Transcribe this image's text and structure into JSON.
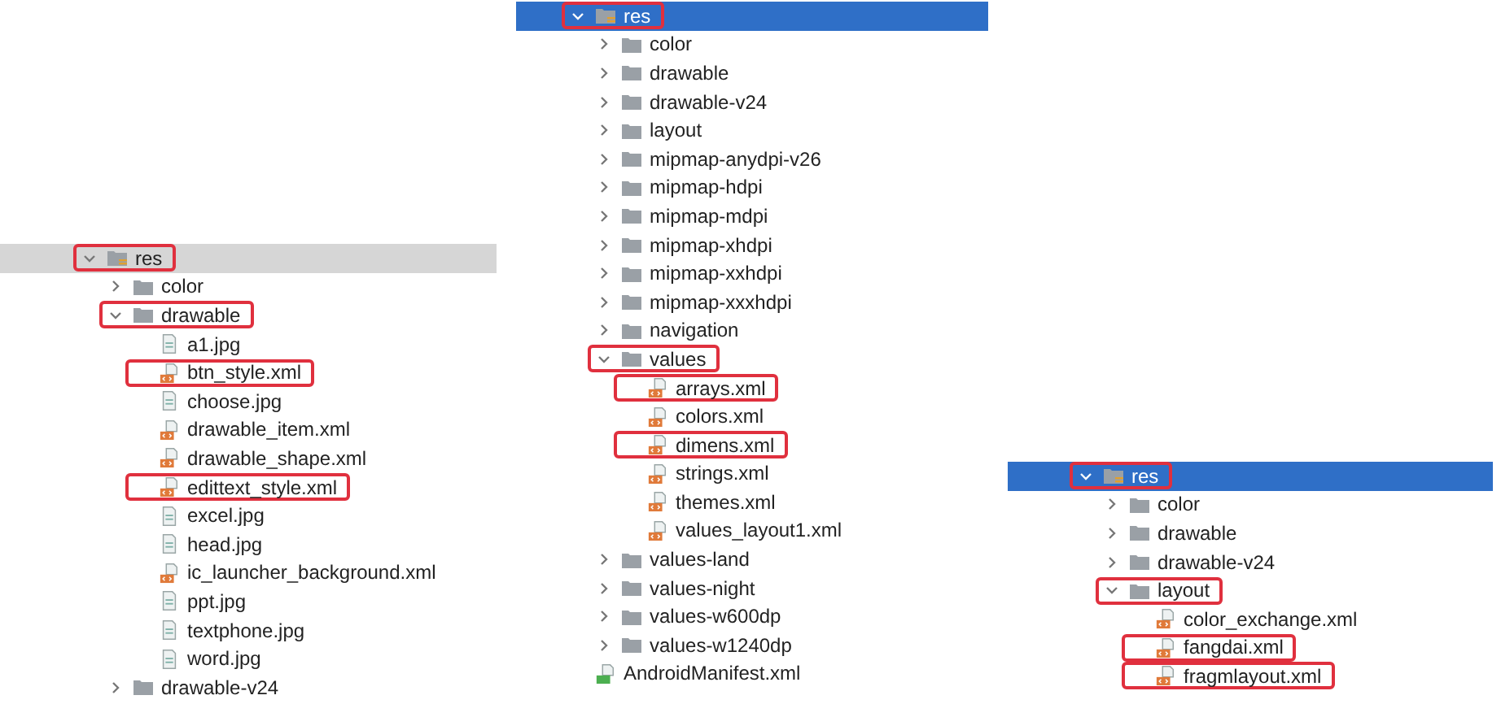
{
  "panels": [
    {
      "focused": false,
      "tree": [
        {
          "name": "res",
          "kind": "resfolder",
          "expanded": true,
          "selected": true,
          "highlighted": true,
          "children": [
            {
              "name": "color",
              "kind": "folder",
              "expanded": false,
              "selected": false,
              "highlighted": false
            },
            {
              "name": "drawable",
              "kind": "folder",
              "expanded": true,
              "selected": false,
              "highlighted": true,
              "children": [
                {
                  "name": "a1.jpg",
                  "kind": "image",
                  "selected": false,
                  "highlighted": false
                },
                {
                  "name": "btn_style.xml",
                  "kind": "xml",
                  "selected": false,
                  "highlighted": true
                },
                {
                  "name": "choose.jpg",
                  "kind": "image",
                  "selected": false,
                  "highlighted": false
                },
                {
                  "name": "drawable_item.xml",
                  "kind": "xml",
                  "selected": false,
                  "highlighted": false
                },
                {
                  "name": "drawable_shape.xml",
                  "kind": "xml",
                  "selected": false,
                  "highlighted": false
                },
                {
                  "name": "edittext_style.xml",
                  "kind": "xml",
                  "selected": false,
                  "highlighted": true
                },
                {
                  "name": "excel.jpg",
                  "kind": "image",
                  "selected": false,
                  "highlighted": false
                },
                {
                  "name": "head.jpg",
                  "kind": "image",
                  "selected": false,
                  "highlighted": false
                },
                {
                  "name": "ic_launcher_background.xml",
                  "kind": "xml",
                  "selected": false,
                  "highlighted": false
                },
                {
                  "name": "ppt.jpg",
                  "kind": "image",
                  "selected": false,
                  "highlighted": false
                },
                {
                  "name": "textphone.jpg",
                  "kind": "image",
                  "selected": false,
                  "highlighted": false
                },
                {
                  "name": "word.jpg",
                  "kind": "image",
                  "selected": false,
                  "highlighted": false
                }
              ]
            },
            {
              "name": "drawable-v24",
              "kind": "folder",
              "expanded": false,
              "selected": false,
              "highlighted": false
            }
          ]
        }
      ]
    },
    {
      "focused": true,
      "tree": [
        {
          "name": "res",
          "kind": "resfolder",
          "expanded": true,
          "selected": true,
          "highlighted": true,
          "children": [
            {
              "name": "color",
              "kind": "folder",
              "expanded": false,
              "selected": false,
              "highlighted": false
            },
            {
              "name": "drawable",
              "kind": "folder",
              "expanded": false,
              "selected": false,
              "highlighted": false
            },
            {
              "name": "drawable-v24",
              "kind": "folder",
              "expanded": false,
              "selected": false,
              "highlighted": false
            },
            {
              "name": "layout",
              "kind": "folder",
              "expanded": false,
              "selected": false,
              "highlighted": false
            },
            {
              "name": "mipmap-anydpi-v26",
              "kind": "folder",
              "expanded": false,
              "selected": false,
              "highlighted": false
            },
            {
              "name": "mipmap-hdpi",
              "kind": "folder",
              "expanded": false,
              "selected": false,
              "highlighted": false
            },
            {
              "name": "mipmap-mdpi",
              "kind": "folder",
              "expanded": false,
              "selected": false,
              "highlighted": false
            },
            {
              "name": "mipmap-xhdpi",
              "kind": "folder",
              "expanded": false,
              "selected": false,
              "highlighted": false
            },
            {
              "name": "mipmap-xxhdpi",
              "kind": "folder",
              "expanded": false,
              "selected": false,
              "highlighted": false
            },
            {
              "name": "mipmap-xxxhdpi",
              "kind": "folder",
              "expanded": false,
              "selected": false,
              "highlighted": false
            },
            {
              "name": "navigation",
              "kind": "folder",
              "expanded": false,
              "selected": false,
              "highlighted": false
            },
            {
              "name": "values",
              "kind": "folder",
              "expanded": true,
              "selected": false,
              "highlighted": true,
              "children": [
                {
                  "name": "arrays.xml",
                  "kind": "xml",
                  "selected": false,
                  "highlighted": true
                },
                {
                  "name": "colors.xml",
                  "kind": "xml",
                  "selected": false,
                  "highlighted": false
                },
                {
                  "name": "dimens.xml",
                  "kind": "xml",
                  "selected": false,
                  "highlighted": true
                },
                {
                  "name": "strings.xml",
                  "kind": "xml",
                  "selected": false,
                  "highlighted": false
                },
                {
                  "name": "themes.xml",
                  "kind": "xml",
                  "selected": false,
                  "highlighted": false
                },
                {
                  "name": "values_layout1.xml",
                  "kind": "xml",
                  "selected": false,
                  "highlighted": false
                }
              ]
            },
            {
              "name": "values-land",
              "kind": "folder",
              "expanded": false,
              "selected": false,
              "highlighted": false
            },
            {
              "name": "values-night",
              "kind": "folder",
              "expanded": false,
              "selected": false,
              "highlighted": false
            },
            {
              "name": "values-w600dp",
              "kind": "folder",
              "expanded": false,
              "selected": false,
              "highlighted": false
            },
            {
              "name": "values-w1240dp",
              "kind": "folder",
              "expanded": false,
              "selected": false,
              "highlighted": false
            }
          ]
        },
        {
          "name": "AndroidManifest.xml",
          "kind": "manifest",
          "selected": false,
          "highlighted": false
        }
      ]
    },
    {
      "focused": true,
      "tree": [
        {
          "name": "res",
          "kind": "resfolder",
          "expanded": true,
          "selected": true,
          "highlighted": true,
          "children": [
            {
              "name": "color",
              "kind": "folder",
              "expanded": false,
              "selected": false,
              "highlighted": false
            },
            {
              "name": "drawable",
              "kind": "folder",
              "expanded": false,
              "selected": false,
              "highlighted": false
            },
            {
              "name": "drawable-v24",
              "kind": "folder",
              "expanded": false,
              "selected": false,
              "highlighted": false
            },
            {
              "name": "layout",
              "kind": "folder",
              "expanded": true,
              "selected": false,
              "highlighted": true,
              "children": [
                {
                  "name": "color_exchange.xml",
                  "kind": "xml",
                  "selected": false,
                  "highlighted": false
                },
                {
                  "name": "fangdai.xml",
                  "kind": "xml",
                  "selected": false,
                  "highlighted": true
                },
                {
                  "name": "fragmlayout.xml",
                  "kind": "xml",
                  "selected": false,
                  "highlighted": true
                }
              ]
            }
          ]
        }
      ]
    }
  ]
}
